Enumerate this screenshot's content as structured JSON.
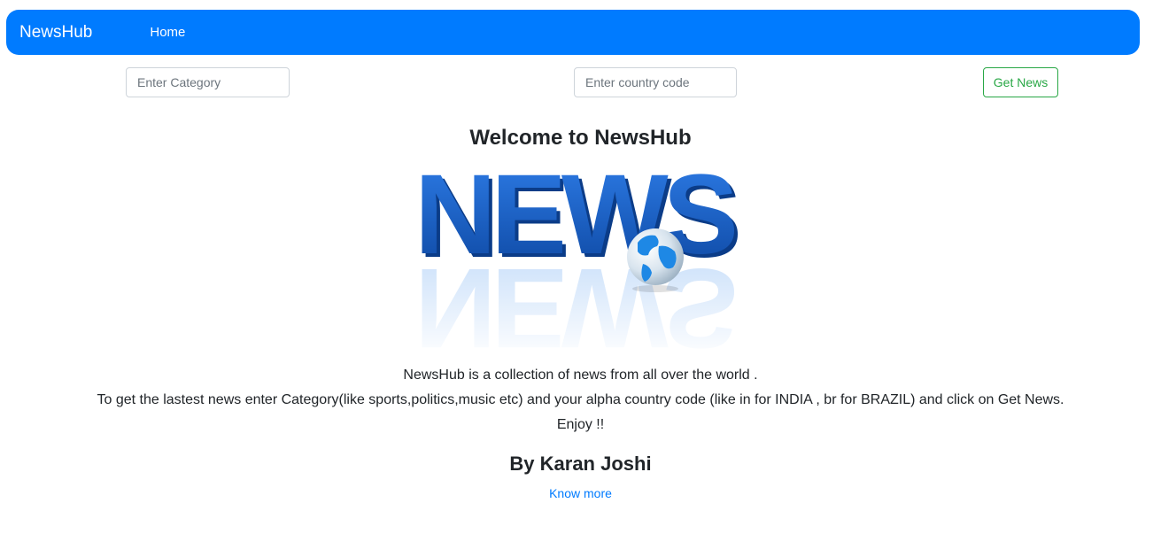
{
  "navbar": {
    "brand": "NewsHub",
    "home_label": "Home"
  },
  "search": {
    "category_placeholder": "Enter Category",
    "category_value": "",
    "country_placeholder": "Enter country code",
    "country_value": "",
    "submit_label": "Get News"
  },
  "main": {
    "welcome_title": "Welcome to NewsHub",
    "logo_text": "NEWS",
    "description_line1": "NewsHub is a collection of news from all over the world .",
    "description_line2": "To get the lastest news enter Category(like sports,politics,music etc) and your alpha country code (like in for INDIA , br for BRAZIL) and click on Get News.",
    "description_line3": "Enjoy !!",
    "author": "By Karan Joshi",
    "know_more_label": "Know more"
  },
  "colors": {
    "primary": "#007bff",
    "success": "#28a745",
    "text": "#212529",
    "logo_blue": "#1565c0"
  },
  "icons": {
    "logo": "globe-icon"
  }
}
